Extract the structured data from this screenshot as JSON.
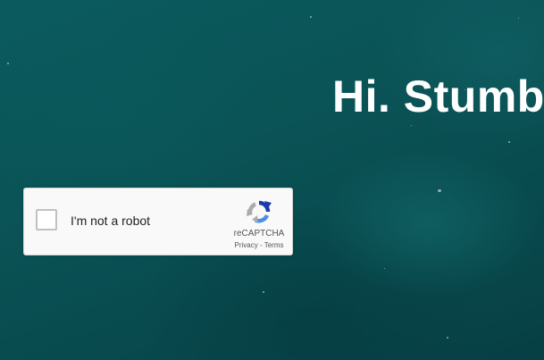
{
  "page": {
    "heading": "Hi. Stumb"
  },
  "captcha": {
    "label": "I'm not a robot",
    "checked": false,
    "brand": "reCAPTCHA",
    "privacy_link": "Privacy",
    "separator": " - ",
    "terms_link": "Terms",
    "icon": "recaptcha-logo-icon"
  },
  "colors": {
    "background": "#0a5558",
    "heading": "#ffffff",
    "captcha_bg": "#f9f9f9",
    "captcha_border": "#d3d3d3",
    "logo_blue_dark": "#1c3aa9",
    "logo_blue_light": "#4a90e2",
    "logo_gray": "#ababab"
  }
}
